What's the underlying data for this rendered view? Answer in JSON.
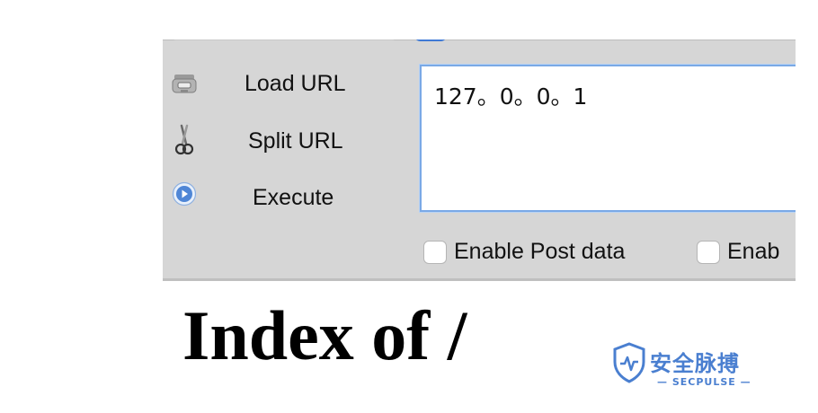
{
  "toolbar": {
    "actions": [
      {
        "label": "Load URL",
        "icon": "load-url-icon"
      },
      {
        "label": "Split URL",
        "icon": "scissors-icon"
      },
      {
        "label": "Execute",
        "icon": "play-icon"
      }
    ]
  },
  "url_field": {
    "value": "127。0。0。1"
  },
  "options": {
    "post_data_label": "Enable Post data",
    "second_label": "Enab"
  },
  "page": {
    "heading": "Index of /"
  },
  "watermark": {
    "text_cn": "安全脉搏",
    "text_en": "— SECPULSE —"
  },
  "colors": {
    "panel_bg": "#d6d6d6",
    "focus_border": "#7aa9e6",
    "accent": "#4a7fd0"
  }
}
